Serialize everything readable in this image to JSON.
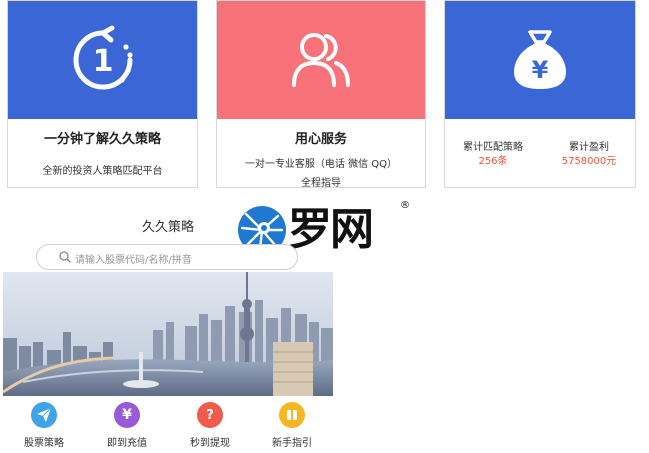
{
  "colors": {
    "blue": "#3a66d6",
    "pink": "#f77379",
    "accent_red": "#e8573f"
  },
  "cards": [
    {
      "icon": "clock-one-minute-icon",
      "title": "一分钟了解久久策略",
      "desc": "全新的投资人策略匹配平台"
    },
    {
      "icon": "users-icon",
      "title": "用心服务",
      "desc_line1": "一对一专业客服（电话 微信 QQ）",
      "desc_line2": "全程指导"
    },
    {
      "icon": "money-bag-icon",
      "stat1_label": "累计匹配策略",
      "stat1_value": "256条",
      "stat2_label": "累计盈利",
      "stat2_value": "5758000元"
    }
  ],
  "section_title": "久久策略",
  "watermark": {
    "text": "罗网",
    "reg": "®"
  },
  "search": {
    "placeholder": "请输入股票代码/名称/拼音"
  },
  "menu": [
    {
      "label": "股票策略",
      "icon": "paper-plane-icon"
    },
    {
      "label": "即到充值",
      "icon": "yen-icon"
    },
    {
      "label": "秒到提现",
      "icon": "question-icon"
    },
    {
      "label": "新手指引",
      "icon": "book-icon"
    }
  ]
}
